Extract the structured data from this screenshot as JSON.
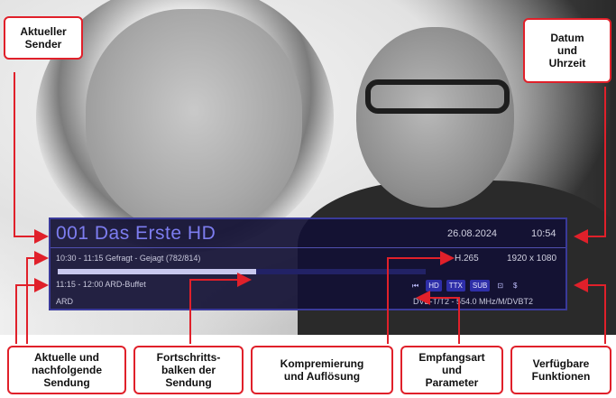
{
  "osd": {
    "channel": "001 Das Erste HD",
    "date": "26.08.2024",
    "time": "10:54",
    "now_program": "10:30 - 11:15 Gefragt - Gejagt (782/814)",
    "next_program": "11:15 - 12:00 ARD-Buffet",
    "progress": 0.54,
    "codec": "H.265",
    "resolution": "1920 x 1080",
    "provider": "ARD",
    "reception": "DVB-T/T2 - 554.0 MHz/M/DVBT2",
    "icons": [
      {
        "name": "rewind-icon",
        "label": "⏮",
        "boxed": false
      },
      {
        "name": "hd-badge-icon",
        "label": "HD",
        "boxed": true
      },
      {
        "name": "teletext-badge-icon",
        "label": "TTX",
        "boxed": true
      },
      {
        "name": "subtitle-badge-icon",
        "label": "SUB",
        "boxed": true
      },
      {
        "name": "lock-icon",
        "label": "⊡",
        "boxed": false
      },
      {
        "name": "dollar-icon",
        "label": "$",
        "boxed": false
      }
    ]
  },
  "callouts": {
    "current_channel": "Aktueller\nSender",
    "date_time": "Datum\nund\nUhrzeit",
    "current_next": "Aktuelle und\nnachfolgende\nSendung",
    "progress_bar": "Fortschritts-\nbalken der\nSendung",
    "compression": "Kompremierung\nund Auflösung",
    "reception": "Empfangsart\nund\nParameter",
    "functions": "Verfügbare\nFunktionen"
  },
  "colors": {
    "callout_border": "#e0202a",
    "osd_background": "#121034",
    "channel_text": "#7d7df0"
  }
}
